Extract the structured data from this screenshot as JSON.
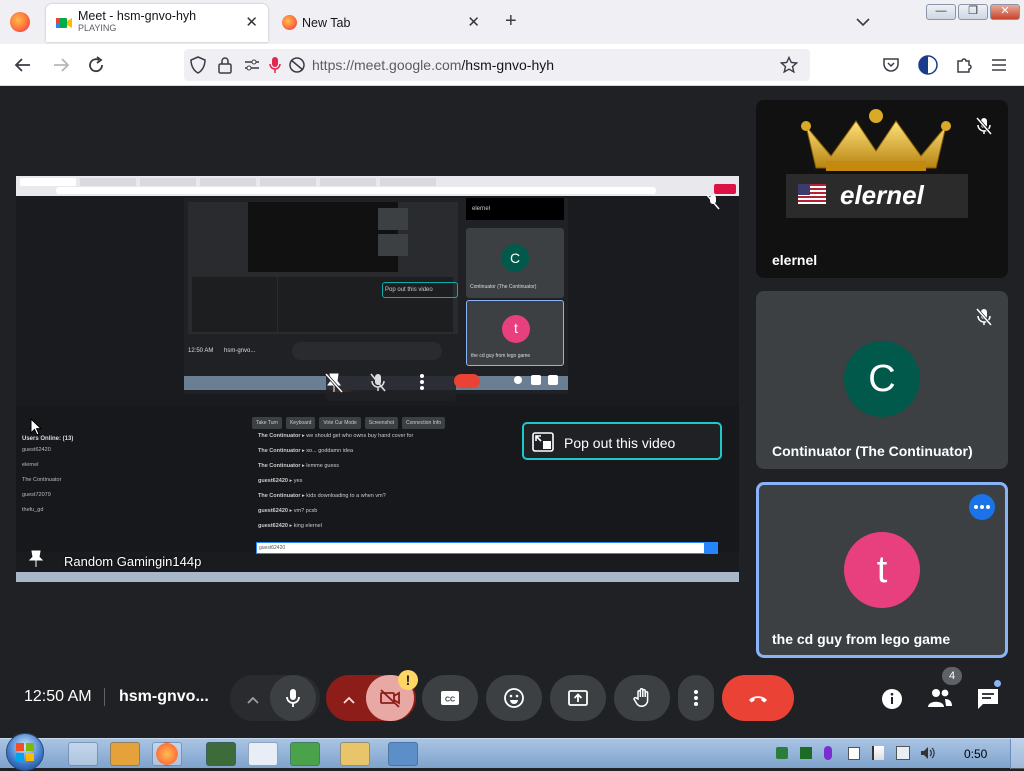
{
  "browser": {
    "tabs": [
      {
        "title": "Meet - hsm-gnvo-hyh",
        "subtitle": "PLAYING",
        "active": true
      },
      {
        "title": "New Tab",
        "active": false
      }
    ],
    "new_tab_label": "+",
    "url_domain": "https://meet.google.com",
    "url_path": "/hsm-gnvo-hyh",
    "window_controls": [
      "minimize",
      "maximize",
      "close"
    ]
  },
  "presentation": {
    "presenter_label": "Random Gamingin144p",
    "popout_label": "Pop out this video",
    "inner": {
      "users_online": "Users Online: (13)",
      "user_list": [
        "guest62420",
        "elernel",
        "The Continuator",
        "guest72079",
        "thefu_gd"
      ],
      "chat_buttons": [
        "Take Turn",
        "Keyboard",
        "Vote Cur Mode",
        "Screenshot",
        "Connection Info"
      ],
      "chat": [
        {
          "user": "The Continuator",
          "text": "we should get who owns buy hand cover for"
        },
        {
          "user": "The Continuator",
          "text": "so... goddamn idea"
        },
        {
          "user": "The Continuator",
          "text": "lemme guess"
        },
        {
          "user": "guest62420",
          "text": "yes"
        },
        {
          "user": "The Continuator",
          "text": "kids downloading to a when vm?"
        },
        {
          "user": "guest62420",
          "text": "vm? pcsb"
        },
        {
          "user": "guest62420",
          "text": "king elernel"
        }
      ],
      "chat_input_user": "guest62420",
      "inner_time": "12:50 AM",
      "inner_code": "hsm-gnvo...",
      "inner_popout": "Pop out this video",
      "inner_tile1_initial": "C",
      "inner_tile1_name": "Continuator (The Continuator)",
      "inner_tile2_initial": "t",
      "inner_tile2_name": "the cd guy from lego game",
      "inner_header": "elernel"
    }
  },
  "participants": [
    {
      "name": "elernel",
      "banner_text": "elernel",
      "muted": true
    },
    {
      "name": "Continuator (The Continuator)",
      "initial": "C",
      "avatar_color": "#00594a",
      "muted": true
    },
    {
      "name": "the cd guy from lego game",
      "initial": "t",
      "avatar_color": "#e8407f",
      "active_speaker": true
    }
  ],
  "controls": {
    "time": "12:50 AM",
    "meeting_code": "hsm-gnvo...",
    "people_count": "4",
    "warning_badge": "!",
    "accent_red": "#ea4335",
    "dark_red": "#8c1d18",
    "active_blue": "#8ab4f8"
  },
  "taskbar": {
    "clock": "0:50"
  }
}
